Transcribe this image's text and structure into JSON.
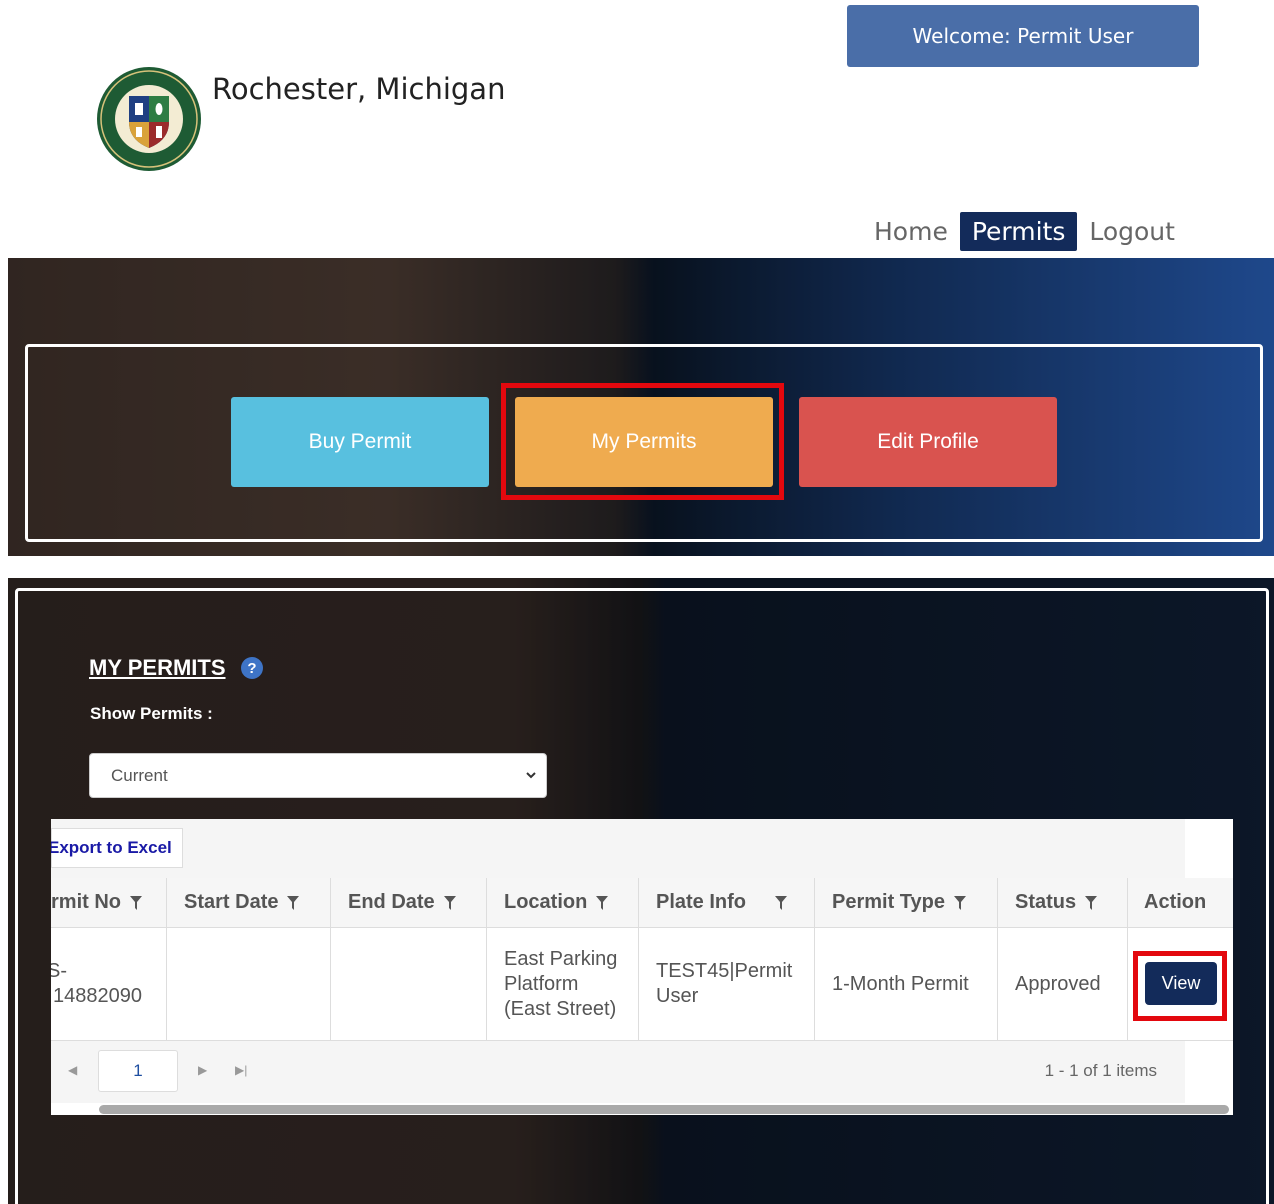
{
  "header": {
    "welcome": "Welcome:  Permit User",
    "city": "Rochester, Michigan",
    "seal": {
      "top_text": "ROCHESTER MICHIGAN",
      "bottom_text": "SETTLED 1817"
    }
  },
  "nav": {
    "items": [
      "Home",
      "Permits",
      "Logout"
    ],
    "active": "Permits"
  },
  "actions": {
    "buy": "Buy Permit",
    "my": "My Permits",
    "edit": "Edit Profile"
  },
  "permits": {
    "title": "MY PERMITS",
    "help": "?",
    "show_label": "Show Permits :",
    "filter_value": "Current",
    "export": "Export to Excel",
    "columns": [
      "rmit No",
      "Start Date",
      "End Date",
      "Location",
      "Plate Info",
      "Permit Type",
      "Status",
      "Action"
    ],
    "rows": [
      {
        "permit_no_line1": "S-",
        "permit_no_line2": "14882090",
        "start_date": "",
        "end_date": "",
        "location": [
          "East Parking",
          "Platform",
          "(East Street)"
        ],
        "plate": [
          "TEST45|Permit",
          "User"
        ],
        "permit_type": "1-Month Permit",
        "status": "Approved",
        "action": "View"
      }
    ],
    "pager": {
      "page": "1",
      "info": "1 - 1 of 1 items"
    }
  },
  "colors": {
    "navy": "#132b5a",
    "buy": "#58c0df",
    "my": "#efab4f",
    "edit": "#d9534f",
    "highlight": "#e3080e",
    "welcome": "#4a6ea8"
  }
}
